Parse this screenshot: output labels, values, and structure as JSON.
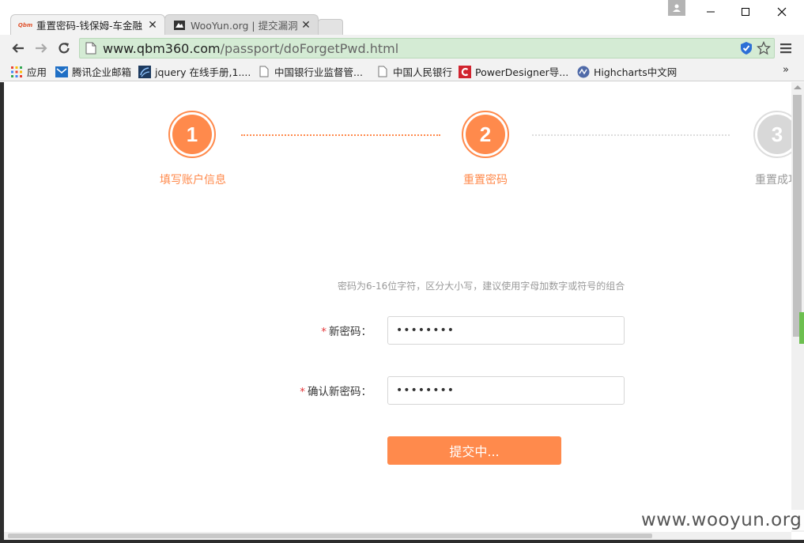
{
  "browser": {
    "tabs": [
      {
        "title": "重置密码-钱保姆-车金融",
        "favicon": "qbm-favicon",
        "favicon_text": "Qbm",
        "active": true
      },
      {
        "title": "WooYun.org | 提交漏洞",
        "favicon": "wooyun-favicon",
        "active": false
      }
    ],
    "address": {
      "host": "www.qbm360.com",
      "path": "/passport/doForgetPwd.html"
    },
    "bookmarks": [
      {
        "label": "应用",
        "icon": "apps-grid-icon"
      },
      {
        "label": "腾讯企业邮箱",
        "icon": "mail-icon"
      },
      {
        "label": "jquery 在线手册,1....",
        "icon": "jquery-icon"
      },
      {
        "label": "中国银行业监督管...",
        "icon": "page-icon"
      },
      {
        "label": "中国人民银行",
        "icon": "page-icon"
      },
      {
        "label": "PowerDesigner导...",
        "icon": "c-logo-icon"
      },
      {
        "label": "Highcharts中文网",
        "icon": "highcharts-icon"
      }
    ],
    "more_label": "»"
  },
  "steps": [
    {
      "number": "1",
      "label": "填写账户信息",
      "state": "done"
    },
    {
      "number": "2",
      "label": "重置密码",
      "state": "current"
    },
    {
      "number": "3",
      "label": "重置成功",
      "state": "pending"
    }
  ],
  "form": {
    "hint": "密码为6-16位字符，区分大小写，建议使用字母加数字或符号的组合",
    "required_mark": "*",
    "new_password_label": "新密码：",
    "new_password_value": "••••••••",
    "confirm_password_label": "确认新密码：",
    "confirm_password_value": "••••••••",
    "submit_label": "提交中..."
  },
  "colors": {
    "accent": "#ff8a4c",
    "omnibox_secure": "#d4ebd4",
    "required": "#e4393c"
  },
  "watermark": "www.wooyun.org"
}
